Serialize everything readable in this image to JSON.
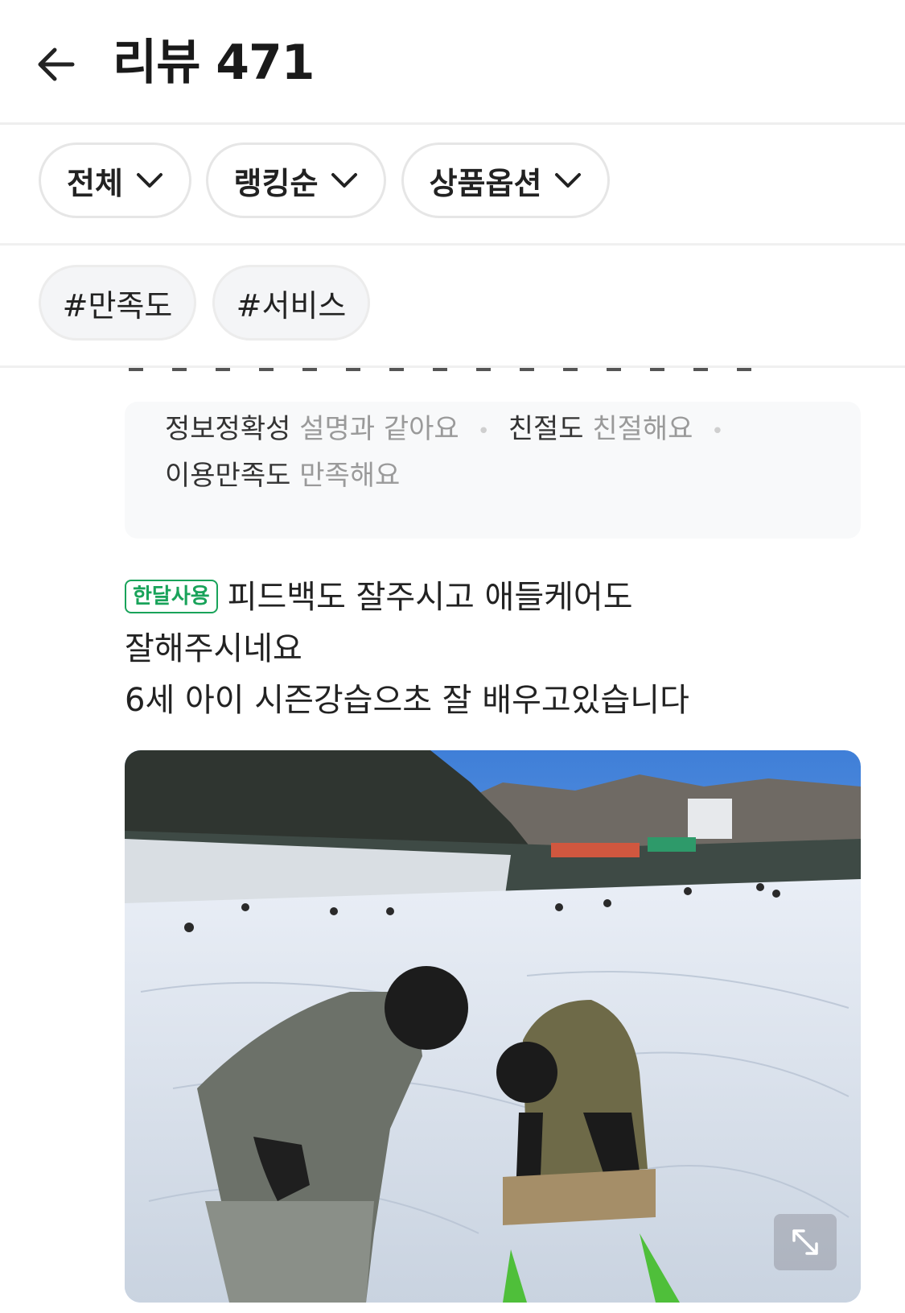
{
  "header": {
    "title": "리뷰 471"
  },
  "filters": [
    {
      "label": "전체"
    },
    {
      "label": "랭킹순"
    },
    {
      "label": "상품옵션"
    }
  ],
  "tags": [
    "#만족도",
    "#서비스"
  ],
  "ratings": {
    "items": [
      {
        "key": "정보정확성",
        "value": "설명과 같아요"
      },
      {
        "key": "친절도",
        "value": "친절해요"
      },
      {
        "key": "이용만족도",
        "value": "만족해요"
      }
    ]
  },
  "review": {
    "badge": "한달사용",
    "line1": "피드백도 잘주시고 애들케어도",
    "line2": "잘해주시네요",
    "line3": "6세 아이 시즌강습으초 잘 배우고있습니다"
  },
  "colors": {
    "badge_green": "#19a35a",
    "rating_key": "#333333",
    "rating_value": "#9a9a9a",
    "pill_border": "#e6e6e6",
    "tag_bg": "#f4f5f7"
  },
  "icons": {
    "back": "arrow-left-icon",
    "dropdown": "chevron-down-icon",
    "expand": "expand-icon"
  },
  "photo": {
    "has_image": true
  }
}
